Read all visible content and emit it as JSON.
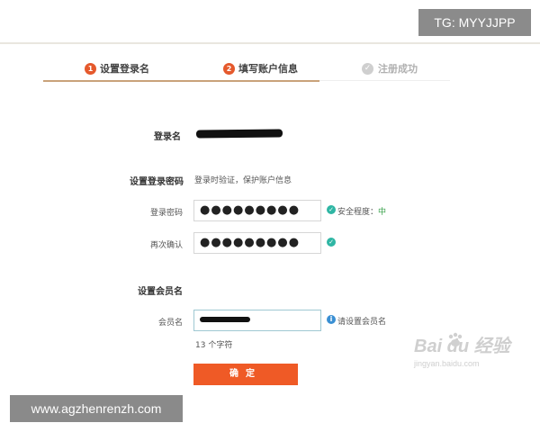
{
  "watermarks": {
    "tg": "TG: MYYJJPP",
    "url": "www.agzhenrenzh.com",
    "baidu": "Bai du 经验",
    "baidu_sub": "jingyan.baidu.com"
  },
  "steps": [
    {
      "num": "1",
      "label": "设置登录名"
    },
    {
      "num": "2",
      "label": "填写账户信息"
    },
    {
      "num": "✓",
      "label": "注册成功"
    }
  ],
  "form": {
    "login_name_label": "登录名",
    "password_section_title": "设置登录密码",
    "password_section_hint": "登录时验证，保护账户信息",
    "password_label": "登录密码",
    "password_value": "●●●●●●●●●",
    "strength_label": "安全程度：",
    "strength_value": "中",
    "confirm_label": "再次确认",
    "confirm_value": "●●●●●●●●●",
    "member_section_title": "设置会员名",
    "member_label": "会员名",
    "member_hint": "请设置会员名",
    "char_count": "13 个字符",
    "submit_label": "确定"
  },
  "colors": {
    "accent": "#ef5a26",
    "step_active": "#e5592c",
    "ok": "#2fb6a4",
    "info": "#3a8fd3"
  }
}
